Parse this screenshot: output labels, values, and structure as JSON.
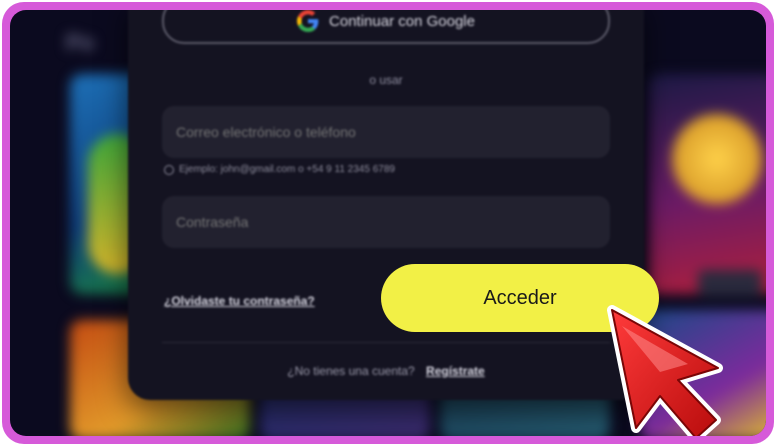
{
  "modal": {
    "google_label": "Continuar con Google",
    "or_text": "o usar",
    "email_placeholder": "Correo electrónico o teléfono",
    "email_hint": "Ejemplo: john@gmail.com o +54 9 11 2345 6789",
    "password_placeholder": "Contraseña",
    "forgot_label": "¿Olvidaste tu contraseña?",
    "submit_label": "Acceder",
    "no_account_text": "¿No tienes una cuenta?",
    "register_label": "Regístrate"
  },
  "background": {
    "section_title": "Po"
  },
  "colors": {
    "frame": "#d65ad9",
    "cta": "#f2f046",
    "cursor": "#e01818"
  },
  "icons": [
    "google-icon",
    "info-icon",
    "pointer-cursor-icon"
  ]
}
